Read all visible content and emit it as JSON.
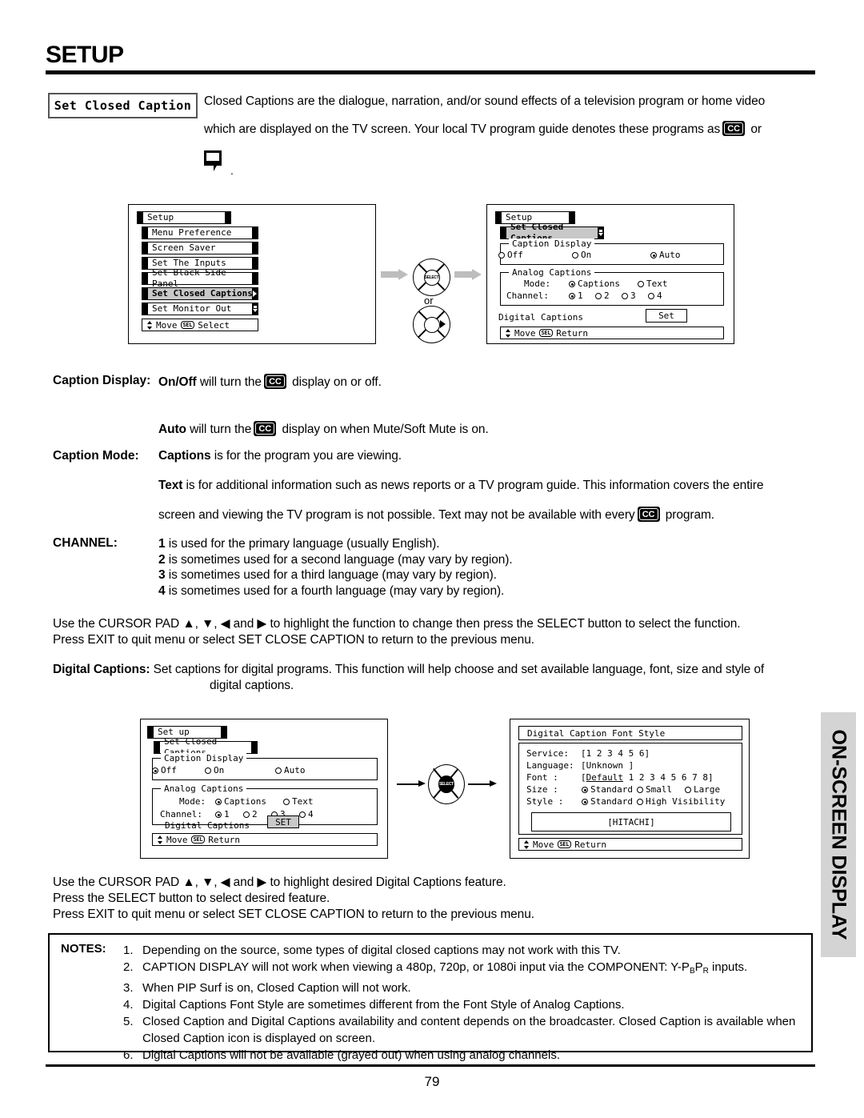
{
  "header": {
    "title": "SETUP",
    "section_tab": "ON-SCREEN DISPLAY",
    "page_number": "79"
  },
  "intro": {
    "box_label": "Set Closed Caption",
    "line1": "Closed Captions are the dialogue, narration, and/or sound effects of a television program or home video",
    "line2_a": "which are displayed on the TV screen.  Your local TV program guide denotes these programs as",
    "line2_b": "or",
    "balloon_trailing": "."
  },
  "diagram_top": {
    "left_menu": {
      "title": "Setup",
      "items": [
        {
          "label": "Menu Preference",
          "selected": false,
          "cap": "plain"
        },
        {
          "label": "Screen Saver",
          "selected": false,
          "cap": "plain"
        },
        {
          "label": "Set The Inputs",
          "selected": false,
          "cap": "plain"
        },
        {
          "label": "Set Black Side Panel",
          "selected": false,
          "cap": "plain"
        },
        {
          "label": "Set Closed Captions",
          "selected": true,
          "cap": "tri"
        },
        {
          "label": "Set Monitor Out",
          "selected": false,
          "cap": "dn"
        }
      ],
      "guide_move": "Move",
      "guide_sel": "SEL",
      "guide_action": "Select"
    },
    "middle": {
      "select_label": "SELECT",
      "or_label": "or"
    },
    "right_menu": {
      "title": "Setup",
      "subtitle": "Set Closed Captions",
      "caption_display": {
        "legend": "Caption Display",
        "options": [
          {
            "label": "Off",
            "checked": false
          },
          {
            "label": "On",
            "checked": false
          },
          {
            "label": "Auto",
            "checked": true
          }
        ]
      },
      "analog_captions": {
        "legend": "Analog Captions",
        "mode_label": "Mode:",
        "mode_options": [
          {
            "label": "Captions",
            "checked": true
          },
          {
            "label": "Text",
            "checked": false
          }
        ],
        "channel_label": "Channel:",
        "channel_options": [
          {
            "label": "1",
            "checked": true
          },
          {
            "label": "2",
            "checked": false
          },
          {
            "label": "3",
            "checked": false
          },
          {
            "label": "4",
            "checked": false
          }
        ]
      },
      "digital_captions_label": "Digital Captions",
      "digital_captions_button": "Set",
      "guide_move": "Move",
      "guide_sel": "SEL",
      "guide_action": "Return"
    }
  },
  "body": {
    "caption_display_label": "Caption Display:",
    "caption_display_line_a": "On/Off",
    "caption_display_line_b": "will turn the",
    "caption_display_line_c": "display on or off.",
    "auto_line_a": "Auto",
    "auto_line_b": "will turn the",
    "auto_line_c": "display on when Mute/Soft Mute is on.",
    "caption_mode_label": "Caption Mode:",
    "captions_line_a": "Captions",
    "captions_line_b": "is for the program you are viewing.",
    "text_line_a": "Text",
    "text_line_b": "is for additional information such as news reports or a TV program guide.  This information covers the entire",
    "text_line_c": "screen and viewing the TV program is not possible.  Text may not be available with every",
    "text_line_d": "program.",
    "channel_label": "CHANNEL:",
    "channel_items": [
      {
        "num": "1",
        "text": "is used for the primary language (usually English)."
      },
      {
        "num": "2",
        "text": "is sometimes used for a second language (may vary by region)."
      },
      {
        "num": "3",
        "text": "is sometimes used for a third language (may vary by region)."
      },
      {
        "num": "4",
        "text": "is sometimes used for a fourth language (may vary by region)."
      }
    ],
    "cursor_line1": "Use the CURSOR PAD ▲, ▼, ◀ and ▶ to highlight the function to change then press the SELECT button to select the function.",
    "cursor_line2": "Press EXIT to quit menu or select SET CLOSE CAPTION to return to the previous menu.",
    "digital_captions_label": "Digital Captions:",
    "digital_captions_line1": "Set captions for digital programs.  This function will help choose and set  available language, font, size and style of",
    "digital_captions_line2": "digital captions."
  },
  "diagram_bottom": {
    "left_menu": {
      "title": "Set up",
      "subtitle": "Set  Closed  Captions",
      "caption_display": {
        "legend": "Caption Display",
        "options": [
          {
            "label": "Off",
            "checked": true
          },
          {
            "label": "On",
            "checked": false
          },
          {
            "label": "Auto",
            "checked": false
          }
        ]
      },
      "analog_captions": {
        "legend": "Analog Captions",
        "mode_label": "Mode:",
        "mode_options": [
          {
            "label": "Captions",
            "checked": true
          },
          {
            "label": "Text",
            "checked": false
          }
        ],
        "channel_label": "Channel:",
        "channel_options": [
          {
            "label": "1",
            "checked": true
          },
          {
            "label": "2",
            "checked": false
          },
          {
            "label": "3",
            "checked": false
          },
          {
            "label": "4",
            "checked": false
          }
        ]
      },
      "digital_captions_label": "Digital  Captions",
      "digital_captions_button": "SET",
      "guide_move": "Move",
      "guide_sel": "SEL",
      "guide_action": "Return"
    },
    "middle": {
      "select_label": "SELECT"
    },
    "right_menu": {
      "title": "Digital  Caption Font  Style",
      "rows": [
        {
          "label": "Service:",
          "value": "[1 2 3 4 5 6]"
        },
        {
          "label": "Language:",
          "value": "[Unknown    ]"
        },
        {
          "label": "Font    :",
          "value": "[Default 1 2 3 4 5 6 7 8]"
        }
      ],
      "size_label": "Size    :",
      "size_options": [
        {
          "label": "Standard",
          "checked": true
        },
        {
          "label": "Small",
          "checked": false
        },
        {
          "label": "Large",
          "checked": false
        }
      ],
      "style_label": "Style   :",
      "style_options": [
        {
          "label": "Standard",
          "checked": true
        },
        {
          "label": "High Visibility",
          "checked": false
        }
      ],
      "preview": "[HITACHI]",
      "guide_move": "Move",
      "guide_sel": "SEL",
      "guide_action": "Return"
    }
  },
  "footer_text": {
    "line1": "Use the CURSOR PAD ▲, ▼, ◀ and ▶ to highlight desired Digital Captions feature.",
    "line2": "Press the SELECT button to select desired feature.",
    "line3": "Press EXIT to quit menu or select SET CLOSE CAPTION to return to the previous menu."
  },
  "notes": {
    "label": "NOTES:",
    "items": [
      {
        "num": "1.",
        "text": "Depending on the source, some types of digital closed captions may not work with this TV."
      },
      {
        "num": "2.",
        "text": "CAPTION DISPLAY will not work when viewing a 480p, 720p, or 1080i input via the COMPONENT: Y-PBPR inputs."
      },
      {
        "num": "3.",
        "text": "When PIP Surf is on, Closed Caption will not work."
      },
      {
        "num": "4.",
        "text": "Digital Captions Font Style are sometimes different from the Font Style of Analog Captions."
      },
      {
        "num": "5.",
        "text": "Closed Caption and Digital Captions availability and content depends on the broadcaster.  Closed Caption is available when Closed Caption icon is displayed on screen."
      },
      {
        "num": "6.",
        "text": "Digital Captions will not be available (grayed out) when using analog channels."
      }
    ]
  }
}
